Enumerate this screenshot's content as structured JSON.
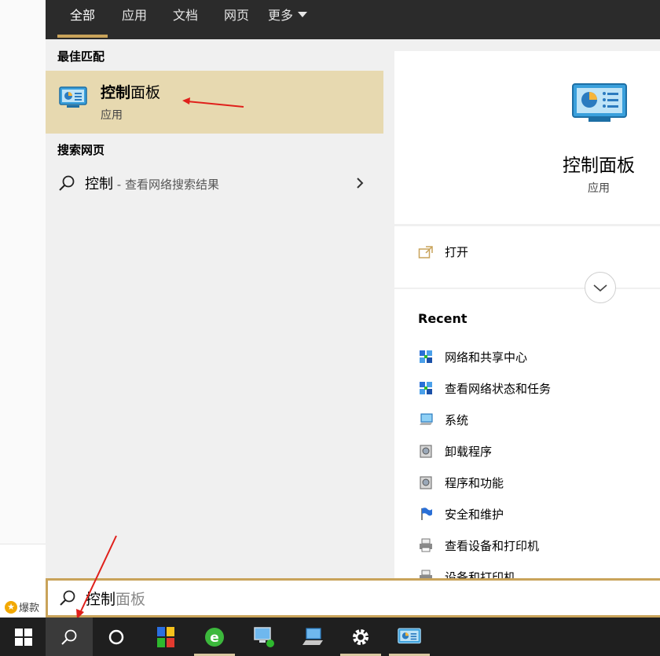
{
  "tabs": [
    {
      "label": "全部",
      "active": true
    },
    {
      "label": "应用"
    },
    {
      "label": "文档"
    },
    {
      "label": "网页"
    },
    {
      "label": "更多"
    }
  ],
  "best_match": {
    "section_title": "最佳匹配",
    "title_bold": "控制",
    "title_rest": "面板",
    "subtitle": "应用"
  },
  "web_search": {
    "section_title": "搜索网页",
    "query": "控制",
    "hint": " - 查看网络搜索结果"
  },
  "detail": {
    "title": "控制面板",
    "subtitle": "应用",
    "open_label": "打开",
    "recent_title": "Recent",
    "recent_items": [
      {
        "label": "网络和共享中心",
        "icon": "network-icon"
      },
      {
        "label": "查看网络状态和任务",
        "icon": "network-icon"
      },
      {
        "label": "系统",
        "icon": "system-icon"
      },
      {
        "label": "卸载程序",
        "icon": "programs-icon"
      },
      {
        "label": "程序和功能",
        "icon": "programs-icon"
      },
      {
        "label": "安全和维护",
        "icon": "flag-icon"
      },
      {
        "label": "查看设备和打印机",
        "icon": "printer-icon"
      },
      {
        "label": "设备和打印机",
        "icon": "printer-icon"
      }
    ]
  },
  "search_box": {
    "typed": "控制",
    "suggestion": "面板"
  },
  "background": {
    "item_label": "爆款"
  },
  "colors": {
    "accent": "#c9a35a",
    "highlight": "#e7d9b0",
    "topbar": "#2b2b2b",
    "taskbar": "#1f1f1f",
    "annotation_arrow": "#e0201b"
  }
}
